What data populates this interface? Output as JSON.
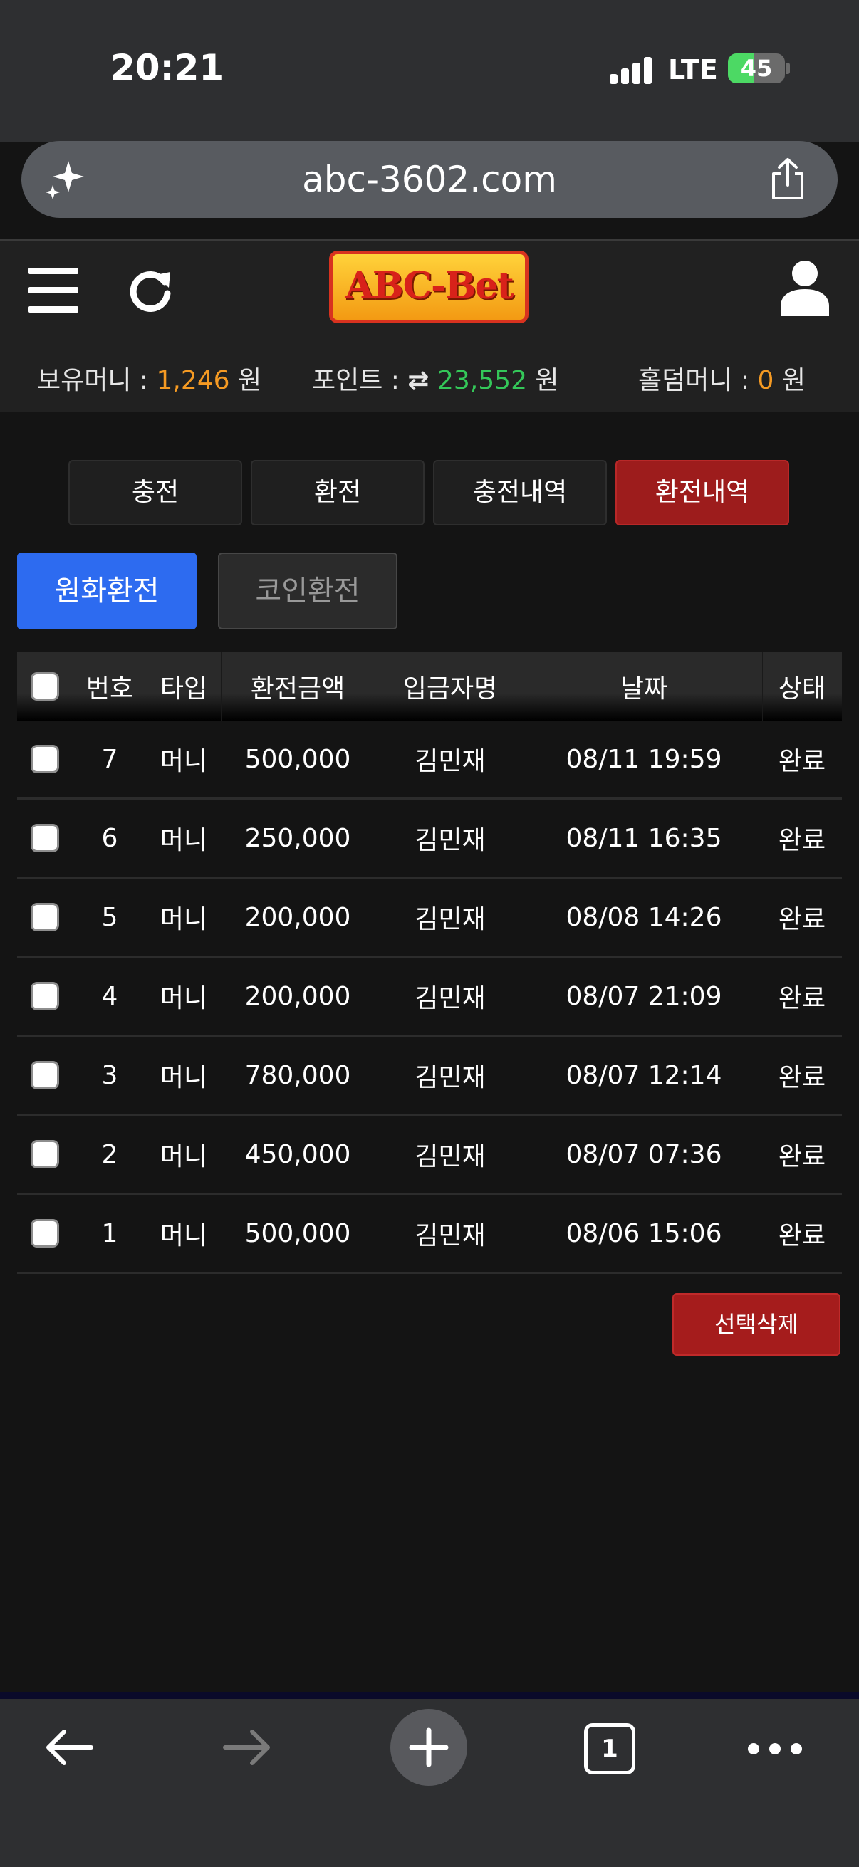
{
  "status_bar": {
    "time": "20:21",
    "network": "LTE",
    "battery": "45",
    "battery_level": 0.45
  },
  "browser": {
    "url": "abc-3602.com"
  },
  "header": {
    "logo_text": "ABC-Bet",
    "balances": [
      {
        "label": "보유머니 : ",
        "value": "1,246",
        "unit": " 원",
        "color": "#f59a23"
      },
      {
        "label": "포인트 : ",
        "icon": "transfer-icon",
        "value": "23,552",
        "unit": " 원",
        "color": "#34c759"
      },
      {
        "label": "홀덤머니 : ",
        "value": "0",
        "unit": " 원",
        "color": "#f59a23"
      }
    ]
  },
  "tabs": [
    {
      "label": "충전",
      "active": false
    },
    {
      "label": "환전",
      "active": false
    },
    {
      "label": "충전내역",
      "active": false
    },
    {
      "label": "환전내역",
      "active": true
    }
  ],
  "subtabs": [
    {
      "label": "원화환전",
      "active": true
    },
    {
      "label": "코인환전",
      "active": false
    }
  ],
  "table": {
    "headers": [
      "번호",
      "타입",
      "환전금액",
      "입금자명",
      "날짜",
      "상태"
    ],
    "rows": [
      {
        "no": "7",
        "type": "머니",
        "amount": "500,000",
        "name": "김민재",
        "date": "08/11 19:59",
        "status": "완료"
      },
      {
        "no": "6",
        "type": "머니",
        "amount": "250,000",
        "name": "김민재",
        "date": "08/11 16:35",
        "status": "완료"
      },
      {
        "no": "5",
        "type": "머니",
        "amount": "200,000",
        "name": "김민재",
        "date": "08/08 14:26",
        "status": "완료"
      },
      {
        "no": "4",
        "type": "머니",
        "amount": "200,000",
        "name": "김민재",
        "date": "08/07 21:09",
        "status": "완료"
      },
      {
        "no": "3",
        "type": "머니",
        "amount": "780,000",
        "name": "김민재",
        "date": "08/07 12:14",
        "status": "완료"
      },
      {
        "no": "2",
        "type": "머니",
        "amount": "450,000",
        "name": "김민재",
        "date": "08/07 07:36",
        "status": "완료"
      },
      {
        "no": "1",
        "type": "머니",
        "amount": "500,000",
        "name": "김민재",
        "date": "08/06 15:06",
        "status": "완료"
      }
    ]
  },
  "actions": {
    "delete_selected": "선택삭제"
  },
  "toolbar": {
    "tab_count": "1"
  }
}
